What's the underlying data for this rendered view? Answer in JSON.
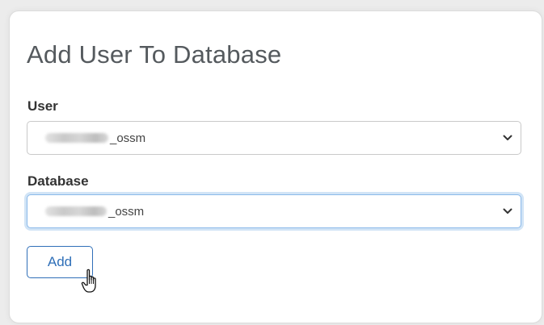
{
  "form": {
    "title": "Add User To Database",
    "user_label": "User",
    "user_value_suffix": "_ossm",
    "database_label": "Database",
    "database_value_suffix": "_ossm",
    "add_button_label": "Add"
  },
  "colors": {
    "accent": "#2f6fb8",
    "focus_ring": "#8bb9ea",
    "title_text": "#555a5e"
  },
  "icons": {
    "select_arrow": "chevron-down-icon",
    "cursor": "hand-pointer-cursor-icon"
  }
}
